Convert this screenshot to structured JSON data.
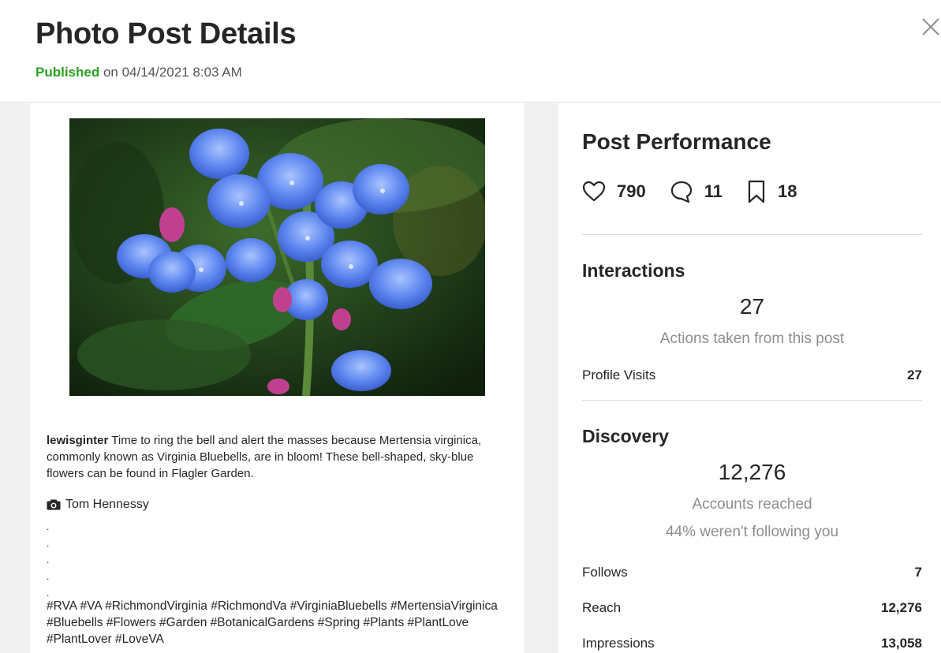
{
  "header": {
    "title": "Photo Post Details",
    "status": "Published",
    "published_suffix": " on 04/14/2021 8:03 AM"
  },
  "post": {
    "username": "lewisginter",
    "caption": " Time to ring the bell and alert the masses because Mertensia virginica, commonly known as Virginia Bluebells, are in bloom! These bell-shaped, sky-blue flowers can be found in Flagler Garden.",
    "credit": "Tom Hennessy",
    "dots": [
      ".",
      ".",
      ".",
      ".",
      "."
    ],
    "hashtags": "#RVA #VA #RichmondVirginia #RichmondVa #VirginiaBluebells #MertensiaVirginica #Bluebells #Flowers #Garden #BotanicalGardens #Spring #Plants #PlantLove #PlantLover #LoveVA"
  },
  "performance": {
    "title": "Post Performance",
    "likes": "790",
    "comments": "11",
    "saves": "18"
  },
  "interactions": {
    "title": "Interactions",
    "total": "27",
    "desc": "Actions taken from this post",
    "rows": [
      {
        "label": "Profile Visits",
        "value": "27"
      }
    ]
  },
  "discovery": {
    "title": "Discovery",
    "total": "12,276",
    "desc": "Accounts reached",
    "note": "44% weren't following you",
    "rows": [
      {
        "label": "Follows",
        "value": "7"
      },
      {
        "label": "Reach",
        "value": "12,276"
      },
      {
        "label": "Impressions",
        "value": "13,058"
      }
    ]
  },
  "colors": {
    "published": "#2ba01f",
    "muted": "#8e8e8e",
    "panel_bg": "#f0f0f0"
  },
  "icons": [
    "close-icon",
    "heart-icon",
    "comment-icon",
    "bookmark-icon",
    "camera-icon"
  ]
}
